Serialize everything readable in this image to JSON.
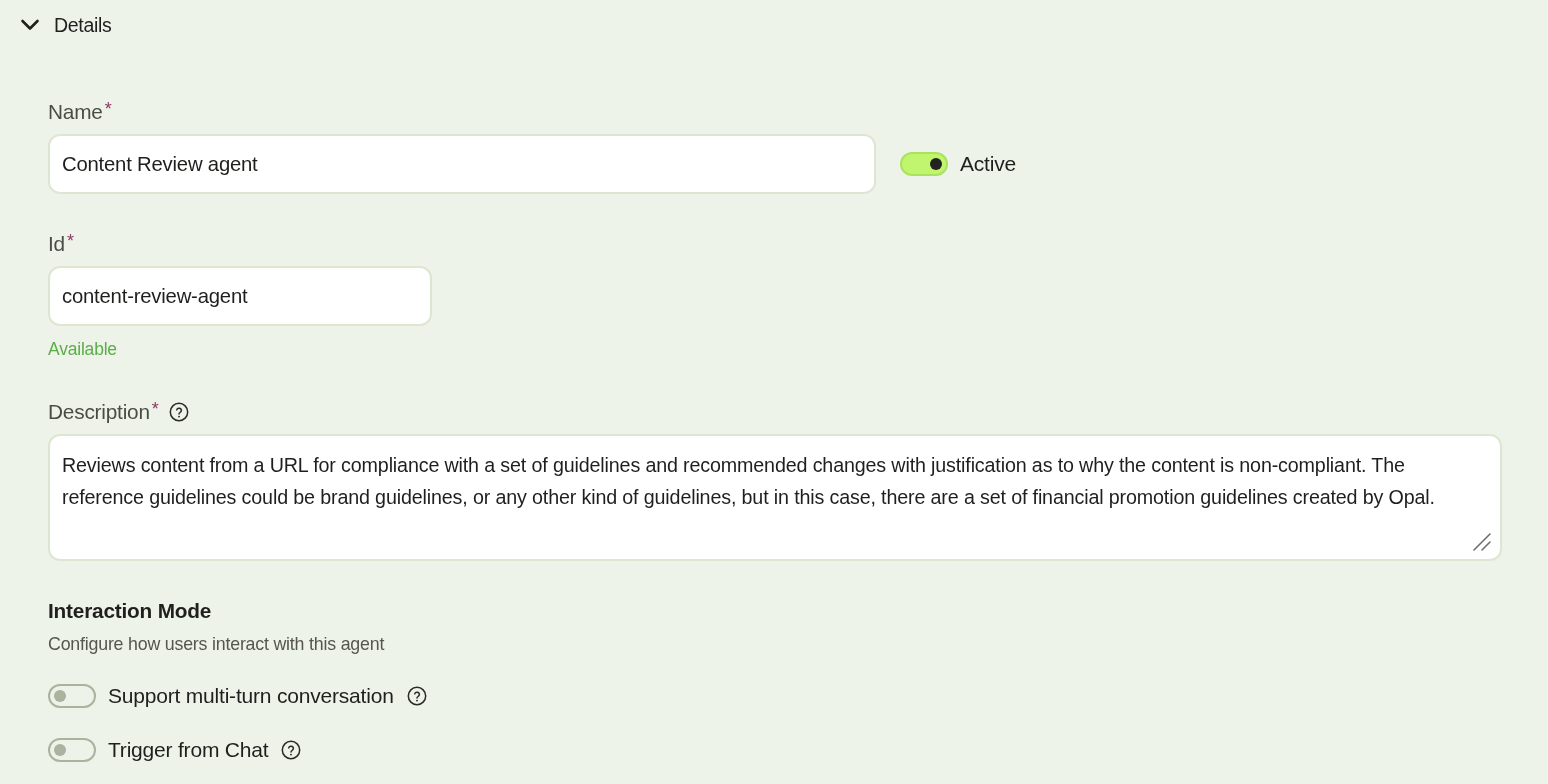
{
  "section": {
    "title": "Details",
    "expanded": true
  },
  "name_field": {
    "label": "Name",
    "required_mark": "*",
    "value": "Content Review agent"
  },
  "active_toggle": {
    "label": "Active",
    "on": true
  },
  "id_field": {
    "label": "Id",
    "required_mark": "*",
    "value": "content-review-agent",
    "status": "Available"
  },
  "description_field": {
    "label": "Description",
    "required_mark": "*",
    "help": true,
    "value": "Reviews content from a URL for compliance with a set of guidelines and recommended changes with justification as to why the content is non-compliant. The reference guidelines could be brand guidelines, or any other kind of guidelines, but in this case, there are a set of financial promotion guidelines created by Opal."
  },
  "interaction_mode": {
    "title": "Interaction Mode",
    "subtitle": "Configure how users interact with this agent",
    "options": [
      {
        "label": "Support multi-turn conversation",
        "on": false,
        "help": true
      },
      {
        "label": "Trigger from Chat",
        "on": false,
        "help": true
      }
    ]
  }
}
